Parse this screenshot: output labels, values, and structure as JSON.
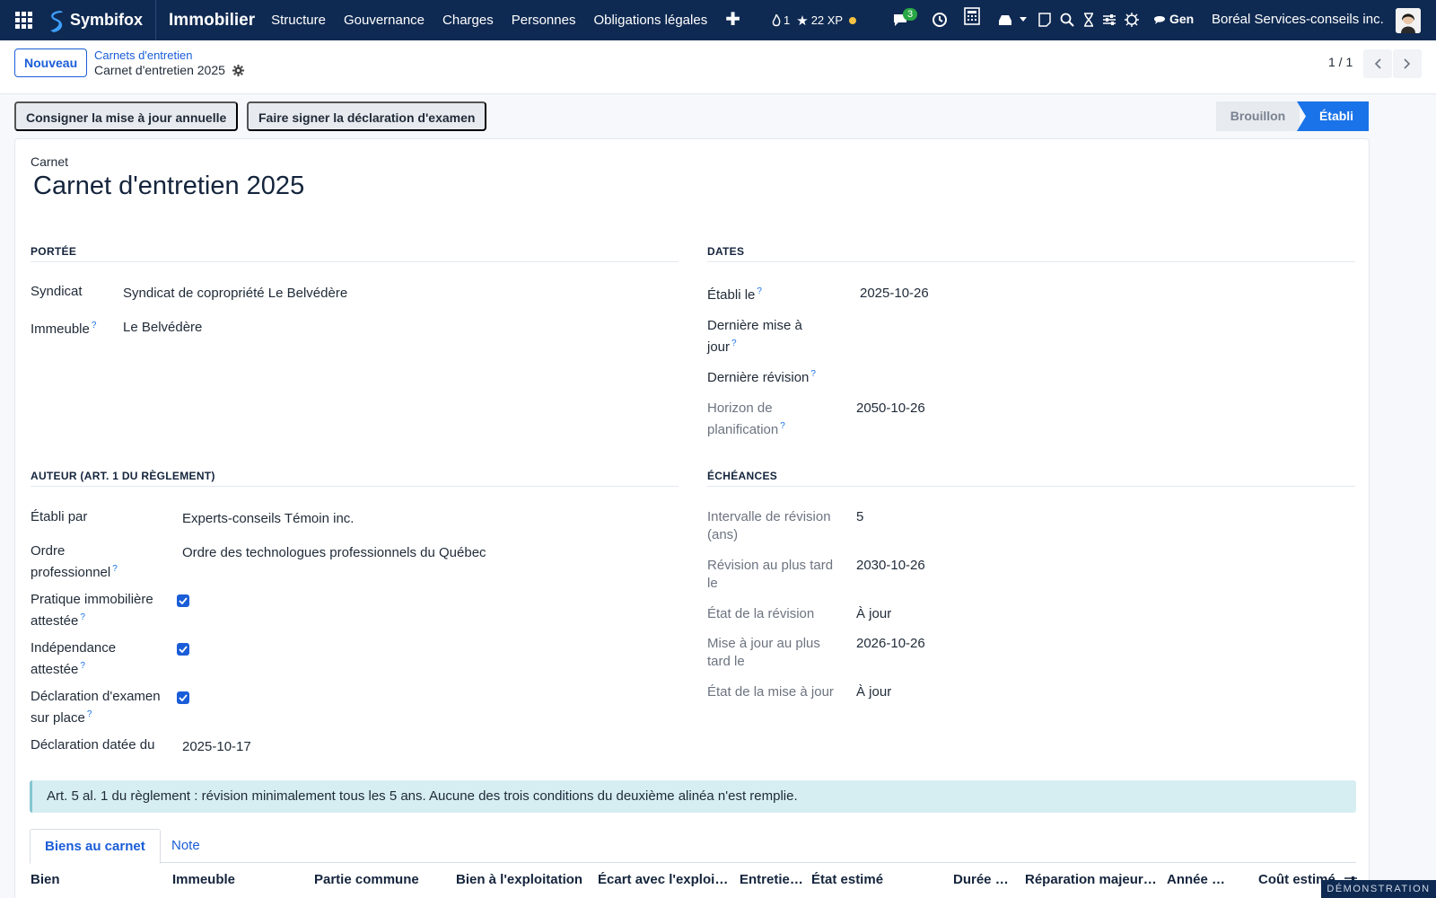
{
  "navbar": {
    "brand": "Symbifox",
    "module": "Immobilier",
    "menu": [
      "Structure",
      "Gouvernance",
      "Charges",
      "Personnes",
      "Obligations légales"
    ],
    "plus": "✚",
    "gami_count": "1",
    "gami_xp": "22 XP",
    "chat_badge": "3",
    "user_short": "Gen",
    "company": "Boréal Services-conseils inc."
  },
  "control": {
    "new_label": "Nouveau",
    "breadcrumb_parent": "Carnets d'entretien",
    "breadcrumb_current": "Carnet d'entretien 2025",
    "pager": "1 / 1"
  },
  "actions": {
    "btn1": "Consigner la mise à jour annuelle",
    "btn2": "Faire signer la déclaration d'examen",
    "status_draft": "Brouillon",
    "status_done": "Établi"
  },
  "form": {
    "record_label": "Carnet",
    "title": "Carnet d'entretien 2025",
    "portee": {
      "heading": "PORTÉE",
      "syndicat_label": "Syndicat",
      "syndicat_value": "Syndicat de copropriété Le Belvédère",
      "immeuble_label": "Immeuble",
      "immeuble_value": "Le Belvédère"
    },
    "dates": {
      "heading": "DATES",
      "etabli_le_label": "Établi le",
      "etabli_le_value": "2025-10-26",
      "derniere_maj_label_1": "Dernière mise à",
      "derniere_maj_label_2": "jour",
      "derniere_revision_label": "Dernière révision",
      "horizon_label_1": "Horizon de",
      "horizon_label_2": "planification",
      "horizon_value": "2050-10-26"
    },
    "auteur": {
      "heading": "AUTEUR (ART. 1 DU RÈGLEMENT)",
      "etabli_par_label": "Établi par",
      "etabli_par_value": "Experts-conseils Témoin inc.",
      "ordre_label_1": "Ordre",
      "ordre_label_2": "professionnel",
      "ordre_value": "Ordre des technologues professionnels du Québec",
      "pratique_label_1": "Pratique immobilière",
      "pratique_label_2": "attestée",
      "independance_label_1": "Indépendance",
      "independance_label_2": "attestée",
      "declaration_label_1": "Déclaration d'examen",
      "declaration_label_2": "sur place",
      "declaration_date_label": "Déclaration datée du",
      "declaration_date_value": "2025-10-17"
    },
    "echeances": {
      "heading": "ÉCHÉANCES",
      "intervalle_label_1": "Intervalle de révision",
      "intervalle_label_2": "(ans)",
      "intervalle_value": "5",
      "revision_tard_label_1": "Révision au plus tard",
      "revision_tard_label_2": "le",
      "revision_tard_value": "2030-10-26",
      "etat_revision_label": "État de la révision",
      "etat_revision_value": "À jour",
      "maj_tard_label_1": "Mise à jour au plus",
      "maj_tard_label_2": "tard le",
      "maj_tard_value": "2026-10-26",
      "etat_maj_label": "État de la mise à jour",
      "etat_maj_value": "À jour"
    },
    "help_mark": "?",
    "alert": "Art. 5 al. 1 du règlement : révision minimalement tous les 5 ans. Aucune des trois conditions du deuxième alinéa n'est remplie."
  },
  "tabs": [
    "Biens au carnet",
    "Note"
  ],
  "table": {
    "headers": [
      "Bien",
      "Immeuble",
      "Partie commune",
      "Bien à l'exploitation",
      "Écart avec l'exploit…",
      "Entretie…",
      "État estimé",
      "Durée d…",
      "Réparation majeur…",
      "Année d…",
      "Coût estimé"
    ]
  },
  "ribbon": "DÉMONSTRATION"
}
